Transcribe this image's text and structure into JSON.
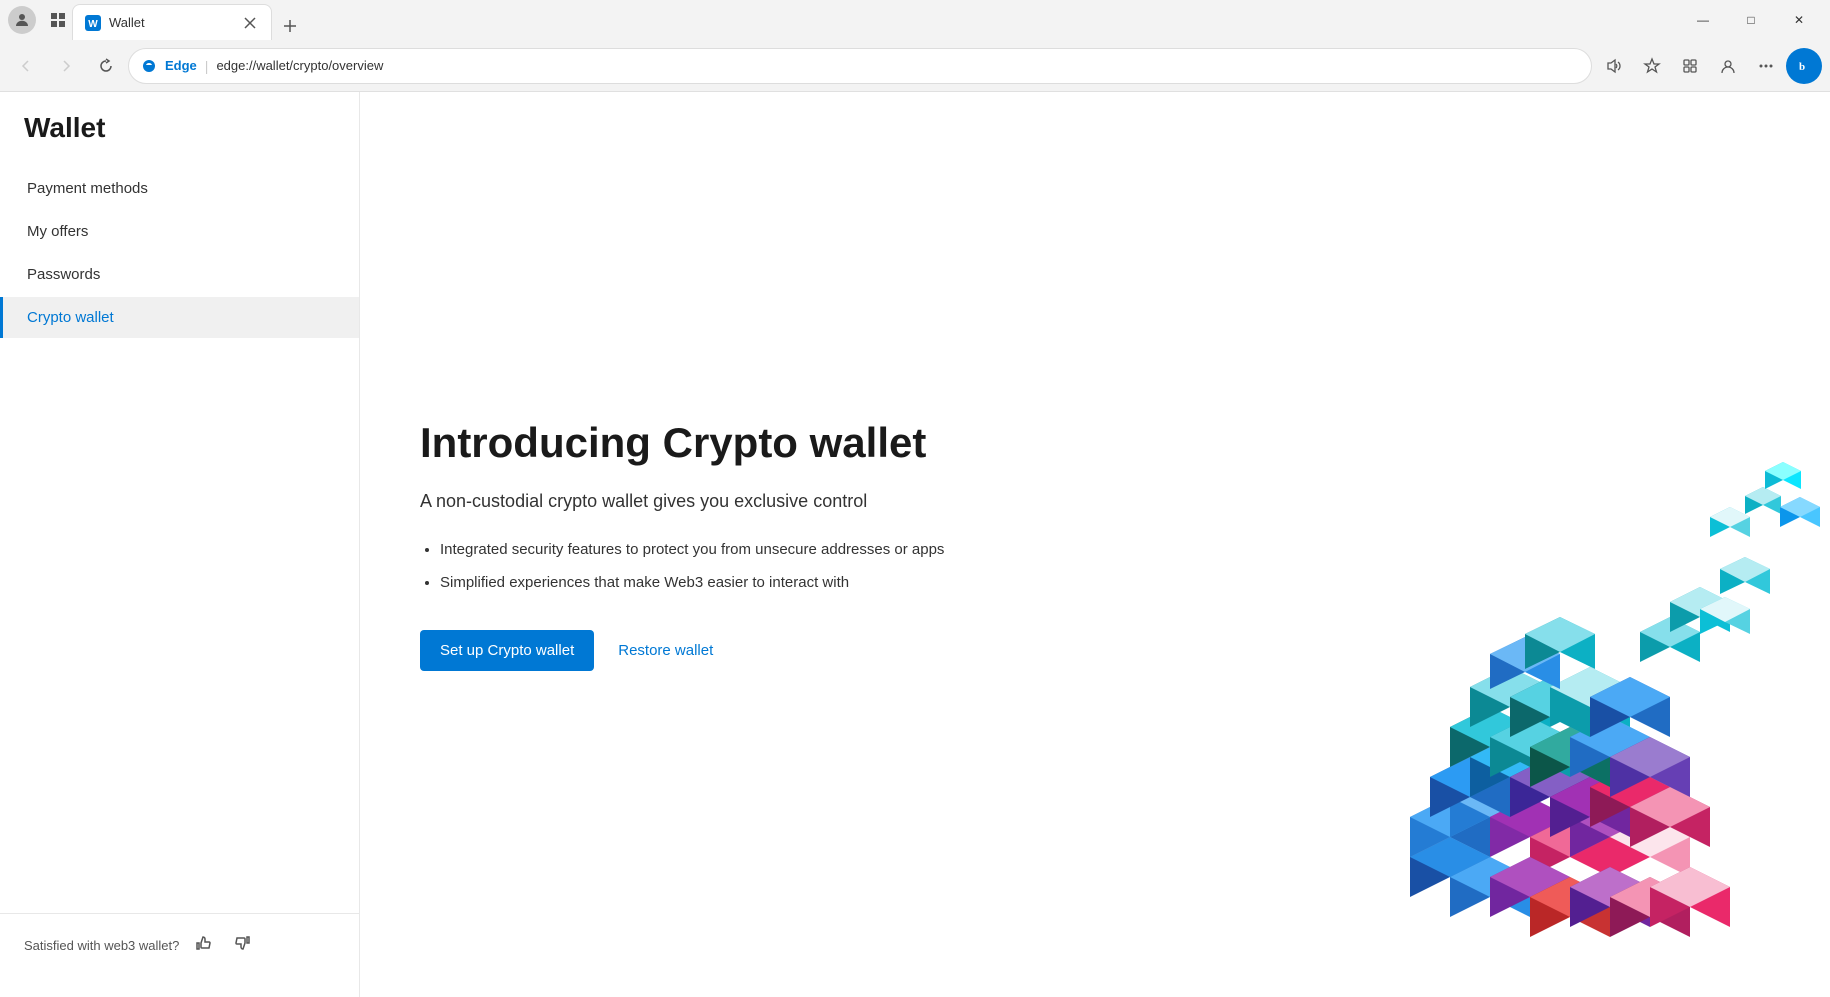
{
  "browser": {
    "tab": {
      "favicon": "wallet",
      "title": "Wallet",
      "close_label": "×"
    },
    "new_tab_label": "+",
    "window_controls": {
      "minimize": "—",
      "maximize": "□",
      "close": "✕"
    },
    "nav": {
      "back_disabled": true,
      "forward_disabled": true,
      "refresh_label": "↻",
      "edge_label": "Edge",
      "address": "edge://wallet/crypto/overview",
      "read_aloud_title": "Read aloud",
      "favorites_title": "Favorites",
      "collections_title": "Collections",
      "profile_title": "Profile",
      "more_title": "More",
      "bing_label": "b"
    }
  },
  "sidebar": {
    "title": "Wallet",
    "nav_items": [
      {
        "id": "payment-methods",
        "label": "Payment methods",
        "active": false
      },
      {
        "id": "my-offers",
        "label": "My offers",
        "active": false
      },
      {
        "id": "passwords",
        "label": "Passwords",
        "active": false
      },
      {
        "id": "crypto-wallet",
        "label": "Crypto wallet",
        "active": true
      }
    ],
    "footer": {
      "satisfied_text": "Satisfied with web3 wallet?",
      "thumbs_up": "👍",
      "thumbs_down": "👎"
    }
  },
  "main": {
    "heading": "Introducing Crypto wallet",
    "subheading": "A non-custodial crypto wallet gives you exclusive control",
    "features": [
      "Integrated security features to protect you from unsecure addresses or apps",
      "Simplified experiences that make Web3 easier to interact with"
    ],
    "setup_button_label": "Set up Crypto wallet",
    "restore_link_label": "Restore wallet"
  }
}
